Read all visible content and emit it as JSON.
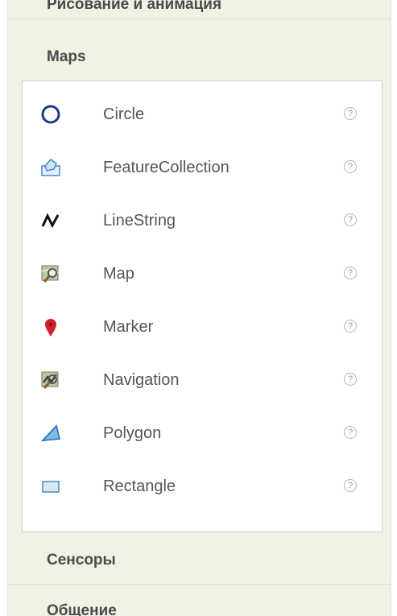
{
  "categories": {
    "top_cut": "Рисование и анимация",
    "maps": "Maps",
    "sensors": "Сенсоры",
    "social": "Общение"
  },
  "maps_components": [
    {
      "label": "Circle",
      "icon": "circle-icon"
    },
    {
      "label": "FeatureCollection",
      "icon": "feature-collection-icon"
    },
    {
      "label": "LineString",
      "icon": "linestring-icon"
    },
    {
      "label": "Map",
      "icon": "map-icon"
    },
    {
      "label": "Marker",
      "icon": "marker-icon"
    },
    {
      "label": "Navigation",
      "icon": "navigation-icon"
    },
    {
      "label": "Polygon",
      "icon": "polygon-icon"
    },
    {
      "label": "Rectangle",
      "icon": "rectangle-icon"
    }
  ],
  "help_glyph": "?",
  "colors": {
    "panel_bg": "#f1f1e6",
    "circle_stroke": "#1b3a8c",
    "marker_red": "#d61f2c",
    "polygon_blue": "#4b9ad6",
    "rectangle_fill": "#d8e8f7"
  }
}
